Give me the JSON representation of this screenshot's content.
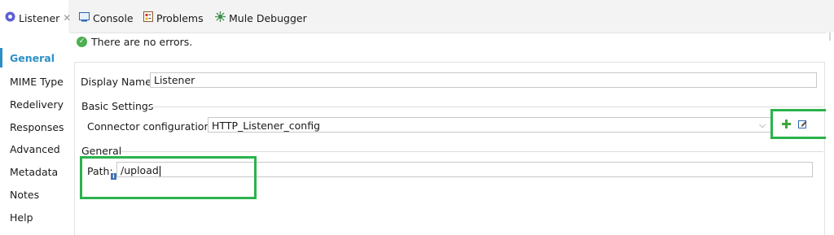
{
  "tabs": [
    {
      "label": "Listener",
      "icon": "listener-icon"
    },
    {
      "label": "Console",
      "icon": "console-icon"
    },
    {
      "label": "Problems",
      "icon": "problems-icon"
    },
    {
      "label": "Mule Debugger",
      "icon": "debugger-icon"
    }
  ],
  "status": {
    "message": "There are no errors."
  },
  "sidebar": {
    "items": [
      {
        "label": "General"
      },
      {
        "label": "MIME Type"
      },
      {
        "label": "Redelivery"
      },
      {
        "label": "Responses"
      },
      {
        "label": "Advanced"
      },
      {
        "label": "Metadata"
      },
      {
        "label": "Notes"
      },
      {
        "label": "Help"
      }
    ]
  },
  "form": {
    "display_name_label": "Display Name:",
    "display_name_value": "Listener",
    "basic_settings_title": "Basic Settings",
    "connector_config_label": "Connector configuration:",
    "connector_config_value": "HTTP_Listener_config",
    "general_title": "General",
    "path_label": "Path:",
    "path_value": "/upload"
  },
  "colors": {
    "accent": "#2c8fc6",
    "highlight": "#2bb24c",
    "ok": "#4caf50"
  }
}
